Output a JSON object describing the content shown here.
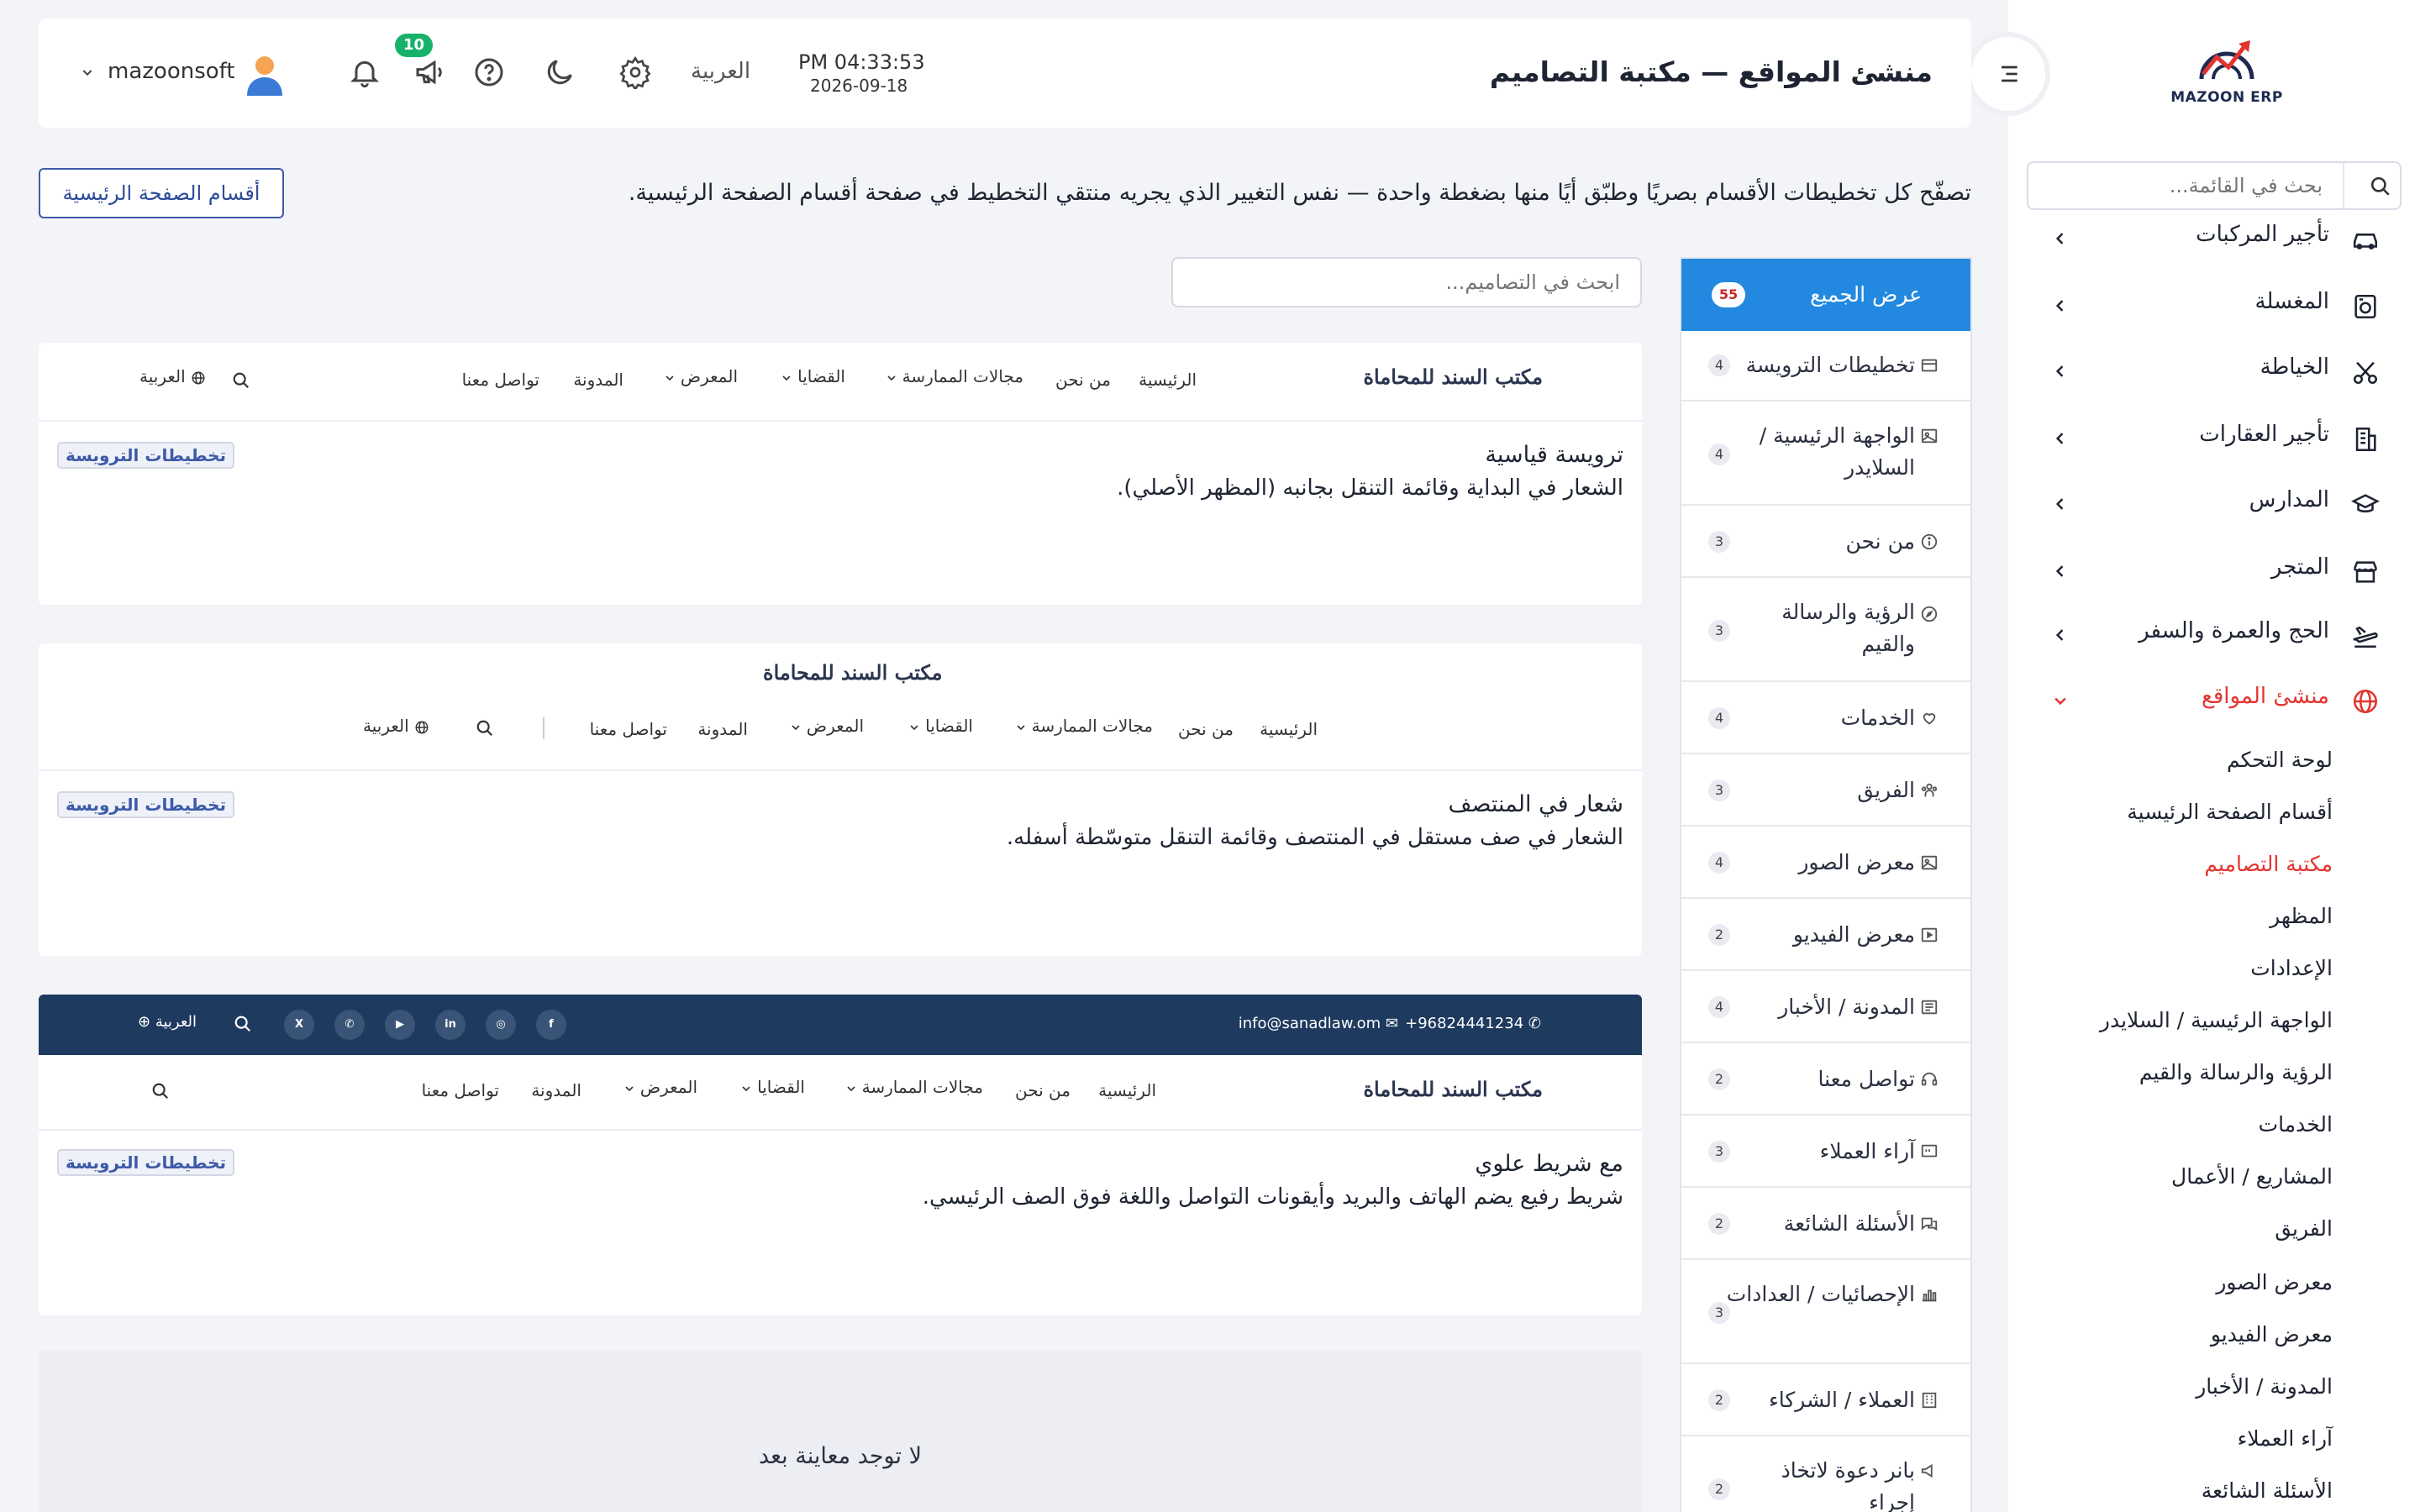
{
  "app": {
    "logo_text": "MAZOON ERP"
  },
  "sidebar": {
    "search_placeholder": "بحث في القائمة...",
    "items": [
      {
        "label": "تأجير المركبات",
        "icon": "car-icon"
      },
      {
        "label": "المغسلة",
        "icon": "laundry-icon"
      },
      {
        "label": "الخياطة",
        "icon": "tailoring-icon"
      },
      {
        "label": "تأجير العقارات",
        "icon": "building-icon"
      },
      {
        "label": "المدارس",
        "icon": "graduation-cap-icon"
      },
      {
        "label": "المتجر",
        "icon": "store-icon"
      },
      {
        "label": "الحج والعمرة والسفر",
        "icon": "plane-icon"
      },
      {
        "label": "منشئ المواقع",
        "icon": "globe-icon"
      }
    ],
    "subitems": [
      "لوحة التحكم",
      "أقسام الصفحة الرئيسية",
      "مكتبة التصاميم",
      "المظهر",
      "الإعدادات",
      "الواجهة الرئيسية / السلايدر",
      "الرؤية والرسالة والقيم",
      "الخدمات",
      "المشاريع / الأعمال",
      "الفريق",
      "معرض الصور",
      "معرض الفيديو",
      "المدونة / الأخبار",
      "آراء العملاء",
      "الأسئلة الشائعة"
    ]
  },
  "header": {
    "title": "منشئ المواقع — مكتبة التصاميم",
    "time": "PM 04:33:53",
    "date": "2026-09-18",
    "language": "العربية",
    "announcements_count": "10",
    "username": "mazoonsoft"
  },
  "intro": {
    "text": "تصفّح كل تخطيطات الأقسام بصريًا وطبّق أيًا منها بضغطة واحدة — نفس التغيير الذي يجريه منتقي التخطيط في صفحة أقسام الصفحة الرئيسية.",
    "button": "أقسام الصفحة الرئيسية"
  },
  "design_search_placeholder": "ابحث في التصاميم...",
  "categories": [
    {
      "label": "عرض الجميع",
      "count": "55",
      "icon": ""
    },
    {
      "label": "تخطيطات الترويسة",
      "count": "4",
      "icon": "layout-icon"
    },
    {
      "label": "الواجهة الرئيسية / السلايدر",
      "count": "4",
      "icon": "image-icon"
    },
    {
      "label": "من نحن",
      "count": "3",
      "icon": "info-icon"
    },
    {
      "label": "الرؤية والرسالة والقيم",
      "count": "3",
      "icon": "compass-icon"
    },
    {
      "label": "الخدمات",
      "count": "4",
      "icon": "heart-hand-icon"
    },
    {
      "label": "الفريق",
      "count": "3",
      "icon": "team-icon"
    },
    {
      "label": "معرض الصور",
      "count": "4",
      "icon": "photos-icon"
    },
    {
      "label": "معرض الفيديو",
      "count": "2",
      "icon": "video-icon"
    },
    {
      "label": "المدونة / الأخبار",
      "count": "4",
      "icon": "newspaper-icon"
    },
    {
      "label": "تواصل معنا",
      "count": "2",
      "icon": "headset-icon"
    },
    {
      "label": "آراء العملاء",
      "count": "3",
      "icon": "quote-icon"
    },
    {
      "label": "الأسئلة الشائعة",
      "count": "2",
      "icon": "chat-icon"
    },
    {
      "label": "الإحصائيات / العدادات",
      "count": "3",
      "icon": "bar-chart-icon"
    },
    {
      "label": "العملاء / الشركاء",
      "count": "2",
      "icon": "building-icon"
    },
    {
      "label": "بانر دعوة لاتخاذ إجراء",
      "count": "2",
      "icon": "megaphone-icon"
    }
  ],
  "preview": {
    "logo": "مكتب السند للمحاماة",
    "nav": [
      "الرئيسية",
      "من نحن",
      "مجالات الممارسة",
      "القضايا",
      "المعرض",
      "المدونة",
      "تواصل معنا"
    ],
    "lang": "العربية",
    "phone": "+96824441234",
    "email": "info@sanadlaw.om"
  },
  "designs": [
    {
      "title": "ترويسة قياسية",
      "desc": "الشعار في البداية وقائمة التنقل بجانبه (المظهر الأصلي).",
      "tag": "تخطيطات الترويسة"
    },
    {
      "title": "شعار في المنتصف",
      "desc": "الشعار في صف مستقل في المنتصف وقائمة التنقل متوسّطة أسفله.",
      "tag": "تخطيطات الترويسة"
    },
    {
      "title": "مع شريط علوي",
      "desc": "شريط رفيع يضم الهاتف والبريد وأيقونات التواصل واللغة فوق الصف الرئيسي.",
      "tag": "تخطيطات الترويسة"
    }
  ],
  "no_preview": "لا توجد معاينة بعد"
}
